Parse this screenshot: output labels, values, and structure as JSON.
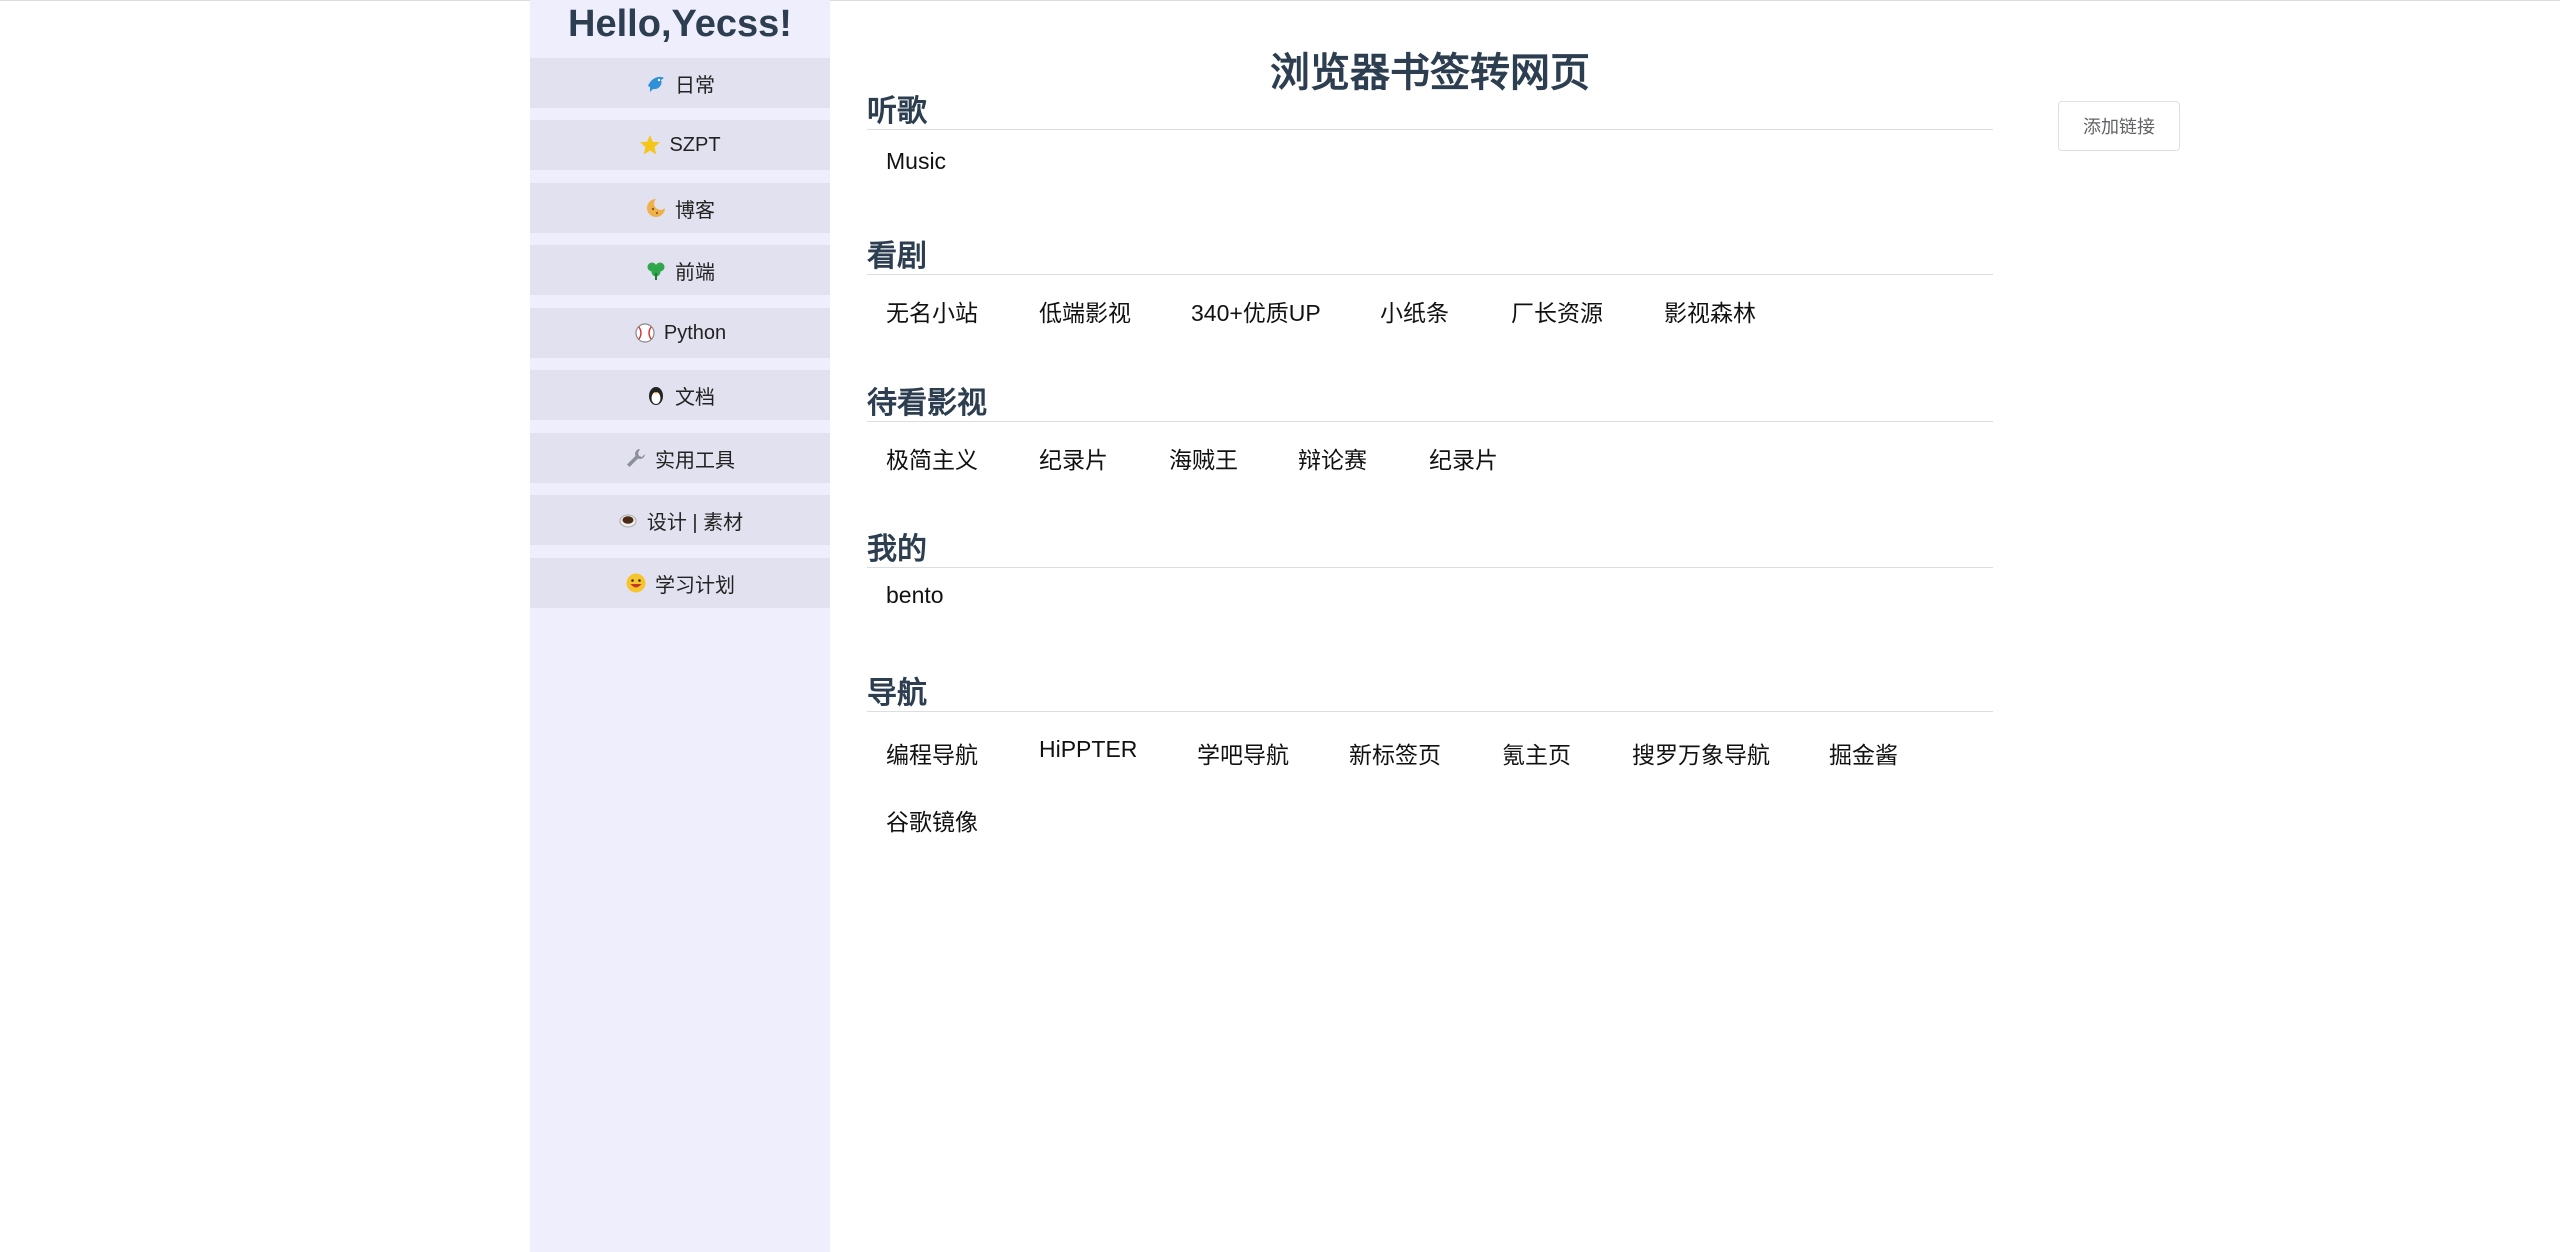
{
  "sidebar": {
    "title": "Hello,Yecss!",
    "items": [
      {
        "label": "日常",
        "icon": "dolphin-icon"
      },
      {
        "label": "SZPT",
        "icon": "star-icon"
      },
      {
        "label": "博客",
        "icon": "cookie-icon"
      },
      {
        "label": "前端",
        "icon": "clover-icon"
      },
      {
        "label": "Python",
        "icon": "baseball-icon"
      },
      {
        "label": "文档",
        "icon": "penguin-icon"
      },
      {
        "label": "实用工具",
        "icon": "wrench-icon"
      },
      {
        "label": "设计 | 素材",
        "icon": "coffee-icon"
      },
      {
        "label": "学习计划",
        "icon": "grinning-face-icon"
      }
    ]
  },
  "main": {
    "title": "浏览器书签转网页",
    "add_button": "添加链接",
    "sections": [
      {
        "title": "听歌",
        "links": [
          "Music"
        ]
      },
      {
        "title": "看剧",
        "links": [
          "无名小站",
          "低端影视",
          "340+优质UP",
          "小纸条",
          "厂长资源",
          "影视森林"
        ]
      },
      {
        "title": "待看影视",
        "links": [
          "极简主义",
          "纪录片",
          "海贼王",
          "辩论赛",
          "纪录片"
        ]
      },
      {
        "title": "我的",
        "links": [
          "bento"
        ]
      },
      {
        "title": "导航",
        "links": [
          "编程导航",
          "HiPPTER",
          "学吧导航",
          "新标签页",
          "氪主页",
          "搜罗万象导航",
          "掘金酱",
          "谷歌镜像"
        ]
      }
    ]
  }
}
